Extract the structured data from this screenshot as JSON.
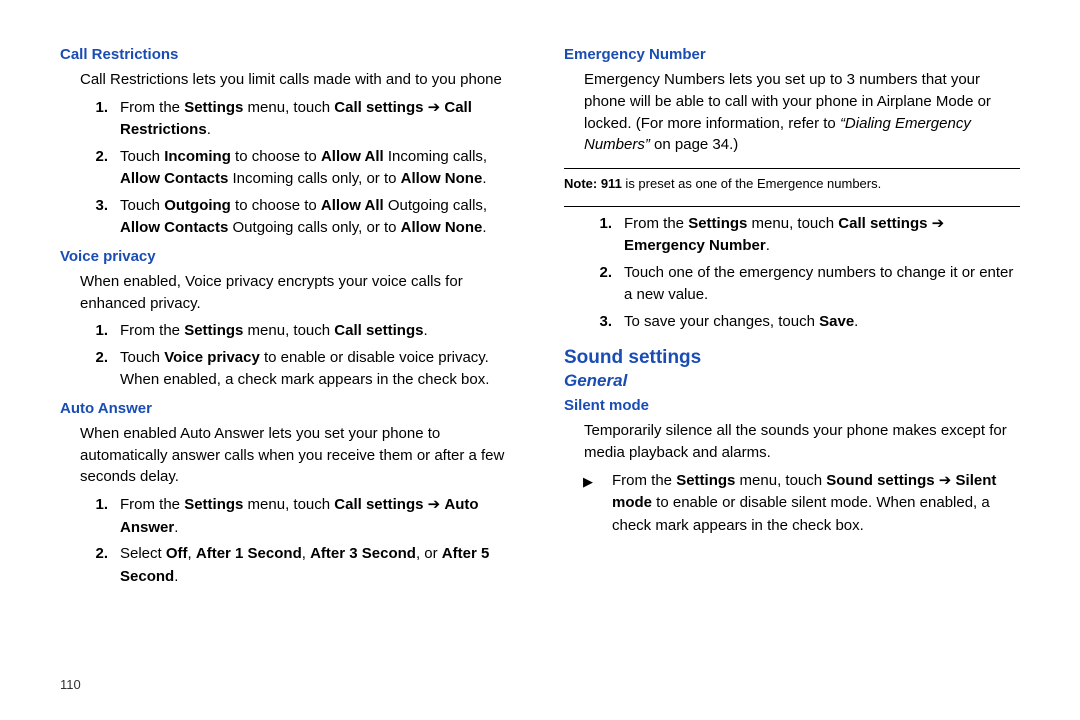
{
  "page_number": "110",
  "left": {
    "h_cr": "Call Restrictions",
    "p_cr": "Call Restrictions lets you limit calls made with and to you phone",
    "cr1_a": "From the ",
    "cr1_b": "Settings",
    "cr1_c": " menu, touch ",
    "cr1_d": "Call settings",
    "cr1_e": " ➔ ",
    "cr1_f": "Call Restrictions",
    "cr1_g": ".",
    "cr2_a": "Touch ",
    "cr2_b": "Incoming",
    "cr2_c": " to choose to ",
    "cr2_d": "Allow All",
    "cr2_e": " Incoming calls, ",
    "cr2_f": "Allow Contacts",
    "cr2_g": " Incoming calls only, or to ",
    "cr2_h": "Allow None",
    "cr2_i": ".",
    "cr3_a": "Touch ",
    "cr3_b": "Outgoing",
    "cr3_c": " to choose to ",
    "cr3_d": "Allow All",
    "cr3_e": " Outgoing calls, ",
    "cr3_f": "Allow Contacts",
    "cr3_g": " Outgoing calls only, or to ",
    "cr3_h": "Allow None",
    "cr3_i": ".",
    "h_vp": "Voice privacy",
    "p_vp": "When enabled, Voice privacy encrypts your voice calls for enhanced privacy.",
    "vp1_a": "From the ",
    "vp1_b": "Settings",
    "vp1_c": " menu, touch ",
    "vp1_d": "Call settings",
    "vp1_e": ".",
    "vp2_a": "Touch ",
    "vp2_b": "Voice privacy",
    "vp2_c": " to enable or disable voice privacy. When enabled, a check mark appears in the check box.",
    "h_aa": "Auto Answer",
    "p_aa": "When enabled Auto Answer lets you set your phone to automatically answer calls when you receive them or after a few seconds delay.",
    "aa1_a": "From the ",
    "aa1_b": "Settings",
    "aa1_c": " menu, touch ",
    "aa1_d": "Call settings",
    "aa1_e": " ➔ ",
    "aa1_f": "Auto Answer",
    "aa1_g": ".",
    "aa2_a": "Select ",
    "aa2_b": "Off",
    "aa2_c": ", ",
    "aa2_d": "After 1 Second",
    "aa2_e": ", ",
    "aa2_f": "After 3 Second",
    "aa2_g": ", or ",
    "aa2_h": "After 5 Second",
    "aa2_i": "."
  },
  "right": {
    "h_en": "Emergency Number",
    "en_p1": "Emergency Numbers lets you set up to 3 numbers that your phone will be able to call with your phone in Airplane Mode or locked. (For more information, refer to ",
    "en_p1_i": "“Dialing Emergency Numbers”",
    "en_p1_b": " on page 34.)",
    "note_a": "Note: 911",
    "note_b": " is preset as one of the Emergence numbers.",
    "en1_a": "From the ",
    "en1_b": "Settings",
    "en1_c": " menu, touch ",
    "en1_d": "Call settings",
    "en1_e": " ➔ ",
    "en1_f": "Emergency Number",
    "en1_g": ".",
    "en2": "Touch one of the emergency numbers to change it or enter a new value.",
    "en3_a": "To save your changes, touch ",
    "en3_b": "Save",
    "en3_c": ".",
    "h_ss": "Sound settings",
    "h_gen": "General",
    "h_sm": "Silent mode",
    "sm_p": "Temporarily silence all the sounds your phone makes except for media playback and alarms.",
    "sm_b_a": "From the ",
    "sm_b_b": "Settings",
    "sm_b_c": " menu, touch ",
    "sm_b_d": "Sound settings",
    "sm_b_e": " ➔ ",
    "sm_b_f": "Silent mode",
    "sm_b_g": " to enable or disable silent mode. When enabled, a check mark appears in the check box."
  },
  "numlabels": {
    "n1": "1.",
    "n2": "2.",
    "n3": "3."
  },
  "triangle": "▶"
}
